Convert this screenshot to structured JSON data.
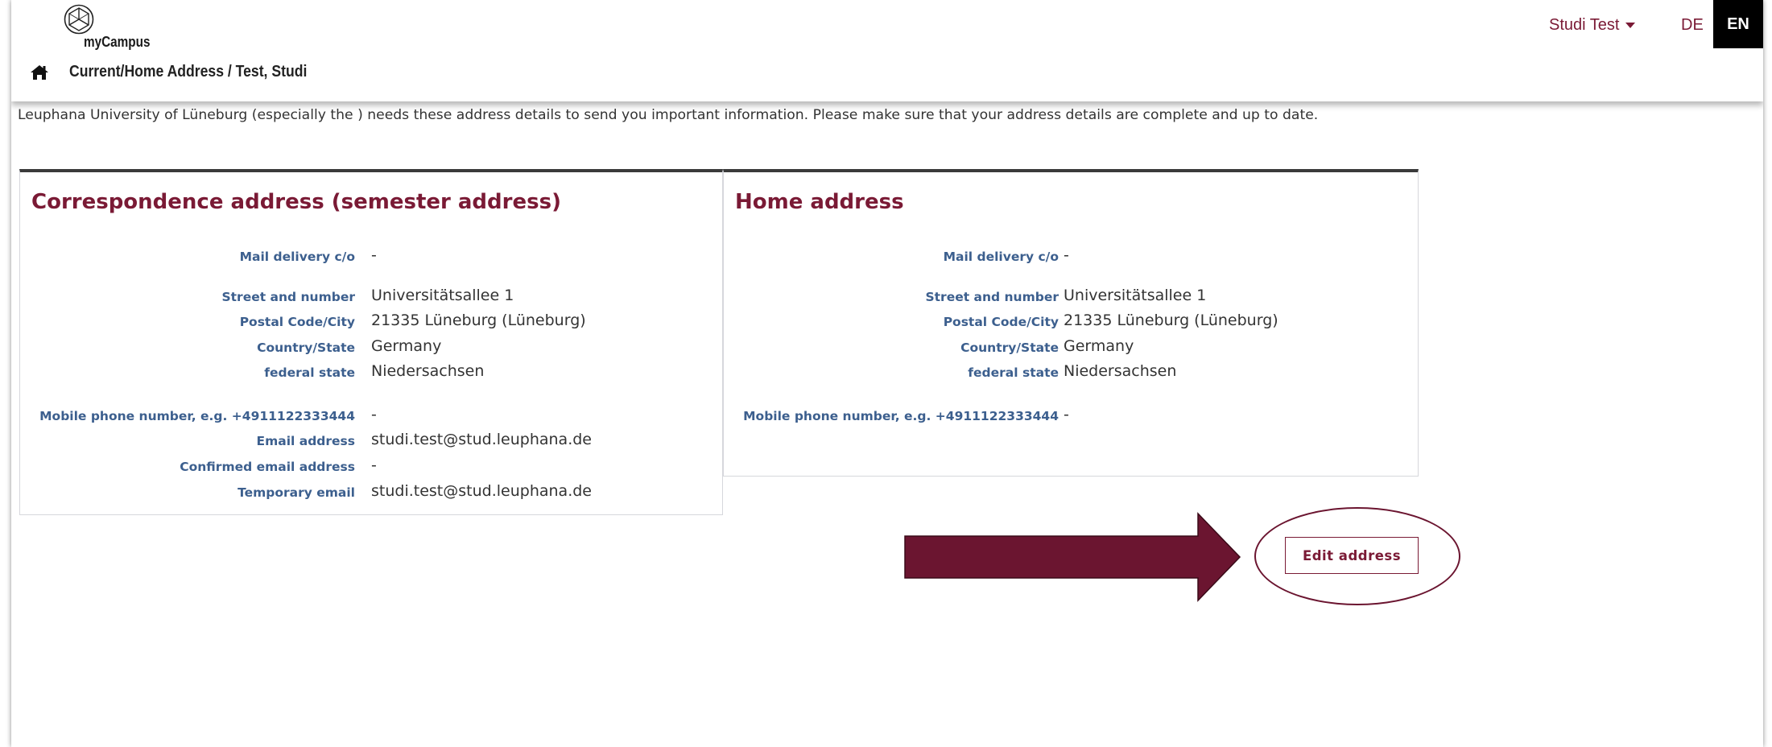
{
  "header": {
    "logo_text": "myCampus",
    "breadcrumb": "Current/Home Address  / Test, Studi",
    "user_menu": "Studi Test",
    "lang_de": "DE",
    "lang_en": "EN"
  },
  "intro_text": "Leuphana University of Lüneburg (especially the ) needs these address details to send you important information. Please make sure that your address details are complete and up to date.",
  "correspondence": {
    "title": "Correspondence address (semester address)",
    "fields": [
      {
        "label": "Mail delivery c/o",
        "value": "-"
      },
      {
        "label": "Street and number",
        "value": "Universitätsallee 1"
      },
      {
        "label": "Postal Code/City",
        "value": "21335 Lüneburg (Lüneburg)"
      },
      {
        "label": "Country/State",
        "value": "Germany"
      },
      {
        "label": "federal state",
        "value": "Niedersachsen"
      },
      {
        "label": "Mobile phone number, e.g. +4911122333444",
        "value": "-"
      },
      {
        "label": "Email address",
        "value": "studi.test@stud.leuphana.de"
      },
      {
        "label": "Confirmed email address",
        "value": "-"
      },
      {
        "label": "Temporary email",
        "value": "studi.test@stud.leuphana.de"
      }
    ]
  },
  "home": {
    "title": "Home address",
    "fields": [
      {
        "label": "Mail delivery c/o",
        "value": "-"
      },
      {
        "label": "Street and number",
        "value": "Universitätsallee 1"
      },
      {
        "label": "Postal Code/City",
        "value": "21335 Lüneburg (Lüneburg)"
      },
      {
        "label": "Country/State",
        "value": "Germany"
      },
      {
        "label": "federal state",
        "value": "Niedersachsen"
      },
      {
        "label": "Mobile phone number, e.g. +4911122333444",
        "value": "-"
      }
    ]
  },
  "edit_button": "Edit address",
  "colors": {
    "brand": "#7a1a35",
    "label_blue": "#3c5f8e",
    "arrow": "#6b1530"
  }
}
